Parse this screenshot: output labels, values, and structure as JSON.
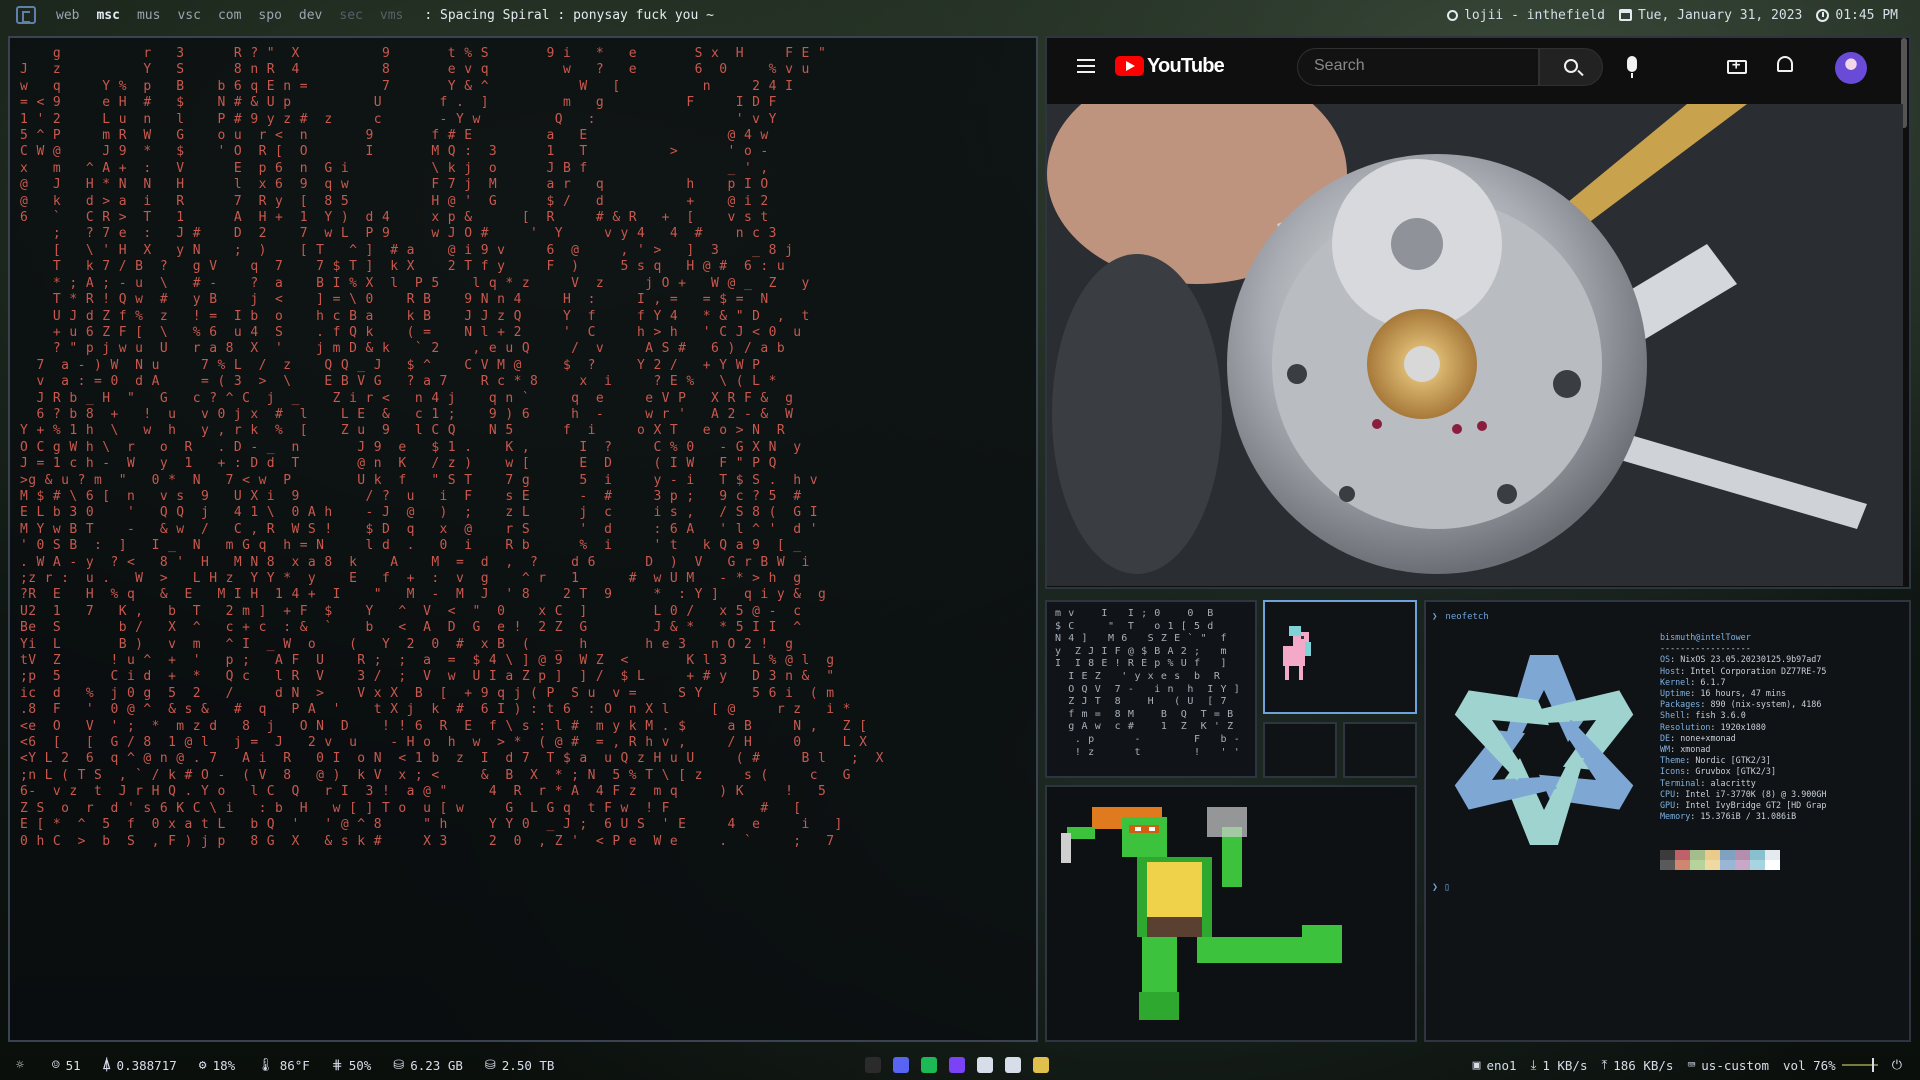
{
  "topbar": {
    "workspaces": [
      {
        "label": "web",
        "state": "normal"
      },
      {
        "label": "msc",
        "state": "active"
      },
      {
        "label": "mus",
        "state": "normal"
      },
      {
        "label": "vsc",
        "state": "normal"
      },
      {
        "label": "com",
        "state": "normal"
      },
      {
        "label": "spo",
        "state": "normal"
      },
      {
        "label": "dev",
        "state": "normal"
      },
      {
        "label": "sec",
        "state": "dim"
      },
      {
        "label": "vms",
        "state": "dim"
      }
    ],
    "window_status": ": Spacing Spiral :  ponysay fuck you ~",
    "user": "lojii - inthefield",
    "date": "Tue, January 31, 2023",
    "time": "01:45 PM"
  },
  "matrix": {
    "rows": [
      "    g          r   3      R ? \"  X          9       t % S       9 i   *   e       S x  H     F E \"",
      "J   z          Y   S      8 n R  4          8       e v q         w   ?   e       6  0     % v u",
      "w   q     Y %  p   B    b 6 q E n =         7       Y & ^           W   [          n     2 4 I",
      "= < 9     e H  #   $    N # & U p          U       f .  ]         m   g          F     I D F",
      "1 ' 2     L u  n   l    P # 9 y z #  z     c       - Y w         Q   :                 ' v Y",
      "5 ^ P     m R  W   G    o u  r <  n       9       f # E         a   E                 @ 4 w",
      "C W @     J 9  *   $    ' O  R [  O       I       M Q :  3      1   T          >      ' o -",
      "x   m   ^ A +  :   V      E  p 6  n  G i          \\ k j  o      J B f                 _ ' ,",
      "@   J   H * N  N   H      l  x 6  9  q w          F 7 j  M      a r   q          h    p I O",
      "@   k   d > a  i   R      7  R y  [  8 5          H @ '  G      $ /   d          +    @ i 2",
      "6   `   C R >  T   1      A  H +  1  Y )  d 4     x p &      [  R     # & R   +  [    v s t",
      "    ;   ? 7 e  :   J #    D  2    7  w L  P 9     w J O #     '  Y     v y 4   4  #    n c 3",
      "    [   \\ ' H  X   y N    ;  )    [ T   ^ ]  # a    @ i 9 v     6  @     , ' >   ]  3    _ 8 j",
      "    T   k 7 / B  ?   g V    q  7    7 $ T ]  k X    2 T f y     F  )     5 s q   H @ #  6 : u",
      "    * ; A ; - u  \\   # -    ?  a    B I % X  l  P 5    l q * z     V  z     j O +   W @ _  Z   y",
      "    T * R ! Q w  #   y B    j  <    ] = \\ 0    R B    9 N n 4     H  :     I , =   = $ =  N",
      "    U J d Z f %  z   ! =  I b  o    h c B a    k B    J J z Q     Y  f     f Y 4   * & \" D  ,  t",
      "    + u 6 Z F [  \\   % 6  u 4  S    . f Q k    ( =    N l + 2     '  C     h > h   ' C J < 0  u",
      "    ? \" p j w u  U   r a 8  X  '    j m D & k   ` 2    , e u Q     /  v     A S #   6 ) / a b",
      "  7  a - ) W  N u     7 % L  /  z    Q Q _ J   $ ^    C V M @     $  ?     Y 2 /   + Y W P",
      "  v  a : = 0  d A     = ( 3  >  \\    E B V G   ? a 7    R c * 8     x  i     ? E %   \\ ( L *",
      "  J R b _ H  \"   G   c ? ^ C  j  _    Z i r <   n 4 j    q n `     q  e     e V P   X R F &  g",
      "  6 ? b 8  +   !  u   v 0 j x  #  l    L E  &   c 1 ;    9 ) 6     h  -     w r '   A 2 - &  W",
      "Y + % 1 h  \\   w  h   y , r k  %  [    Z u  9   l C Q    N 5      f  i     o X T   e o > N  R",
      "O C g W h \\  r   o  R   . D - _  n       J 9  e   $ 1 .    K ,      I  ?     C % 0   - G X N  y",
      "J = 1 c h -  W   y  1   + : D d  T       @ n  K   / z )    w [      E  D     ( I W   F \" P Q",
      ">g & u ? m  \"   0 *  N   7 < w  P        U k  f   \" S T    7 g      5  i     y - i   T $ S .  h v",
      "M $ # \\ 6 [  n   v s  9   U X i  9        / ?  u   i  F    s E      -  #     3 p ;   9 c ? 5  #",
      "E L b 3 0    '   Q Q  j   4 1 \\  0 A h    - J  @   )  ;    z L      j  c     i s ,   / S 8 (  G I",
      "M Y w B T    -   & w  /   C , R  W S !    $ D  q   x  @    r S      '  d     : 6 A   ' l ^ '  d '",
      "' 0 S B  :  ]   I _  N   m G q  h = N     l d  .   0  i    R b      %  i     ' t   k Q a 9  [ _",
      ". W A - y  ? <   8 '  H   M N 8  x a 8  k    A    M  =  d  ,  ?    d 6      D  )  V   G r B W  i",
      ";z r :  u .   W  >   L H z  Y Y *  y    E   f  +  :  v  g    ^ r   1      #  w U M   - * > h  g",
      "?R  E   H  % q   &  E   M I H  1 4 +  I    \"   M  -  M  J  ' 8    2 T  9     *  : Y ]   q i y &  g",
      "U2  1   7   K ,   b  T   2 m ]  + F  $    Y   ^  V  <  \"  0    x C  ]        L 0 /   x 5 @ -  c",
      "Be  S       b /   X  ^   c + c  : &  `    b   <  A  D  G  e !  2 Z  G        J & *   * 5 I I  ^",
      "Yi  L       B )   v  m   ^ I  _ W  o    (   Y  2  0  #  x B  (   _  h       h e 3   n O 2 !  g",
      "tV  Z      ! u ^  +  '   p ;   A F  U    R ;  ;  a  =  $ 4 \\ ] @ 9  W Z  <       K l 3   L % @ l  g",
      ";p  5      C i d  +  *   Q c   l R  V    3 /  ;  V  w  U I a Z p ]  ] /  $ L     + # y   D 3 n &  \"",
      "ic  d   %  j 0 g  5  2   /     d N  >    V x X  B  [  + 9 q j ( P  S u  v =     S Y      5 6 i  ( m",
      ".8  F   '  0 @ ^  & s &   #  q   P A  '    t X j  k  #  6 I ) : t 6  : O  n X l     [ @     r z   i *",
      "<e  O   V  ' ;  *  m z d   8  j   O N  D    ! ! 6  R  E  f \\ s : l #  m y k M . $     a B     N ,   Z [",
      "<6  [   [  G / 8  1 @ l   j =  J   2 v  u    - H o  h  w  > *  ( @ #  = , R h v ,     / H     0     L X",
      "<Y L 2  6  q ^ @ n @ . 7   A i  R   0 I  o N  < 1 b  z  I  d 7  T $ a  u Q z H u U     ( #     B l   ;  X",
      ";n L ( T S  , ` / k # O -  ( V  8   @ )  k V  x ; <     &  B  X  * ; N  5 % T \\ [ z     s (     c   G",
      "6-  v z  t  J r H Q . Y o   l C  Q   r I  3 !  a @ \"     4  R  r * A  4 F z  m q     ) K     !   5",
      "Z S  o  r  d ' s 6 K C \\ i   : b  H   w [ ] T o  u [ w     G  L G q  t F w  ! F           #   [",
      "E [ *  ^  5  f  0 x a t L   b Q  '   ' @ ^ 8     \" h     Y Y 0  _ J ;  6 U S  ' E     4  e     i   ]",
      "0 h C  >  b  S  , F ) j p   8 G  X   & s k #     X 3     2  0  , Z '  < P e  W e     .  `     ;   7"
    ]
  },
  "youtube": {
    "brand": "YouTube",
    "search_placeholder": "Search"
  },
  "scramble": {
    "rows": [
      "m v    I   I ; 0    0  B",
      "$ C     \"  T   o 1 [ 5 d",
      "N 4 ]   M 6   S Z E ` \"  f",
      "y  Z J I F @ $ B A 2 ;   m",
      "I  I 8 E ! R E p % U f   ]",
      "  I E Z   ' y x e s  b  R",
      "  O Q V  7 -   i n  h  I Y ]",
      "  Z J T  8    H   ( U  [ 7",
      "  f m =  8 M    B  Q  T = B",
      "  g A w  c #    1  Z  K ' Z",
      "   . p      -        F   b -",
      "   ! z      t        !   ' '"
    ]
  },
  "neofetch": {
    "command": "neofetch",
    "userhost": "bismuth@intelTower",
    "separator": "------------------",
    "lines": [
      {
        "key": "OS",
        "value": "NixOS 23.05.20230125.9b97ad7"
      },
      {
        "key": "Host",
        "value": "Intel Corporation DZ77RE-75"
      },
      {
        "key": "Kernel",
        "value": "6.1.7"
      },
      {
        "key": "Uptime",
        "value": "16 hours, 47 mins"
      },
      {
        "key": "Packages",
        "value": "890 (nix-system), 4186"
      },
      {
        "key": "Shell",
        "value": "fish 3.6.0"
      },
      {
        "key": "Resolution",
        "value": "1920x1080"
      },
      {
        "key": "DE",
        "value": "none+xmonad"
      },
      {
        "key": "WM",
        "value": "xmonad"
      },
      {
        "key": "Theme",
        "value": "Nordic [GTK2/3]"
      },
      {
        "key": "Icons",
        "value": "Gruvbox [GTK2/3]"
      },
      {
        "key": "Terminal",
        "value": "alacritty"
      },
      {
        "key": "CPU",
        "value": "Intel i7-3770K (8) @ 3.900GH"
      },
      {
        "key": "GPU",
        "value": "Intel IvyBridge GT2 [HD Grap"
      },
      {
        "key": "Memory",
        "value": "15.376iB / 31.086iB"
      }
    ],
    "swatches": [
      "#3b3b3b",
      "#bf616a",
      "#a3be8c",
      "#ebcb8b",
      "#81a1c1",
      "#b48ead",
      "#88c0d0",
      "#e5e9f0",
      "#5a5a5a",
      "#d08770",
      "#b5d39a",
      "#f0d9a0",
      "#9ab6d6",
      "#c9a7c6",
      "#a8d4e0",
      "#ffffff"
    ],
    "logo_colors": {
      "blue": "#7ea7d4",
      "teal": "#9fd3cf"
    }
  },
  "bottombar": {
    "items": [
      {
        "icon": "workspace-icon",
        "glyph": "☼",
        "value": ""
      },
      {
        "icon": "ghost-icon",
        "glyph": "☺",
        "value": "51"
      },
      {
        "icon": "load-icon",
        "glyph": "⍋",
        "value": "0.388717"
      },
      {
        "icon": "cpu-icon",
        "glyph": "⚙",
        "value": "18%"
      },
      {
        "icon": "temperature-icon",
        "glyph": "🌡",
        "value": "86°F"
      },
      {
        "icon": "memory-icon",
        "glyph": "⋕",
        "value": "50%"
      },
      {
        "icon": "disk-icon",
        "glyph": "⛁",
        "value": "6.23 GB"
      },
      {
        "icon": "storage-icon",
        "glyph": "⛁",
        "value": "2.50 TB"
      }
    ],
    "tray_colors": [
      "#2b2b2b",
      "#5865f2",
      "#1db954",
      "#7b42f6",
      "#d8dee9",
      "#d8dee9",
      "#e0c04c"
    ],
    "network_iface": "eno1",
    "download": "1 KB/s",
    "upload": "186 KB/s",
    "keyboard": "us-custom",
    "volume": "vol 76%",
    "volume_level": 0.76
  }
}
